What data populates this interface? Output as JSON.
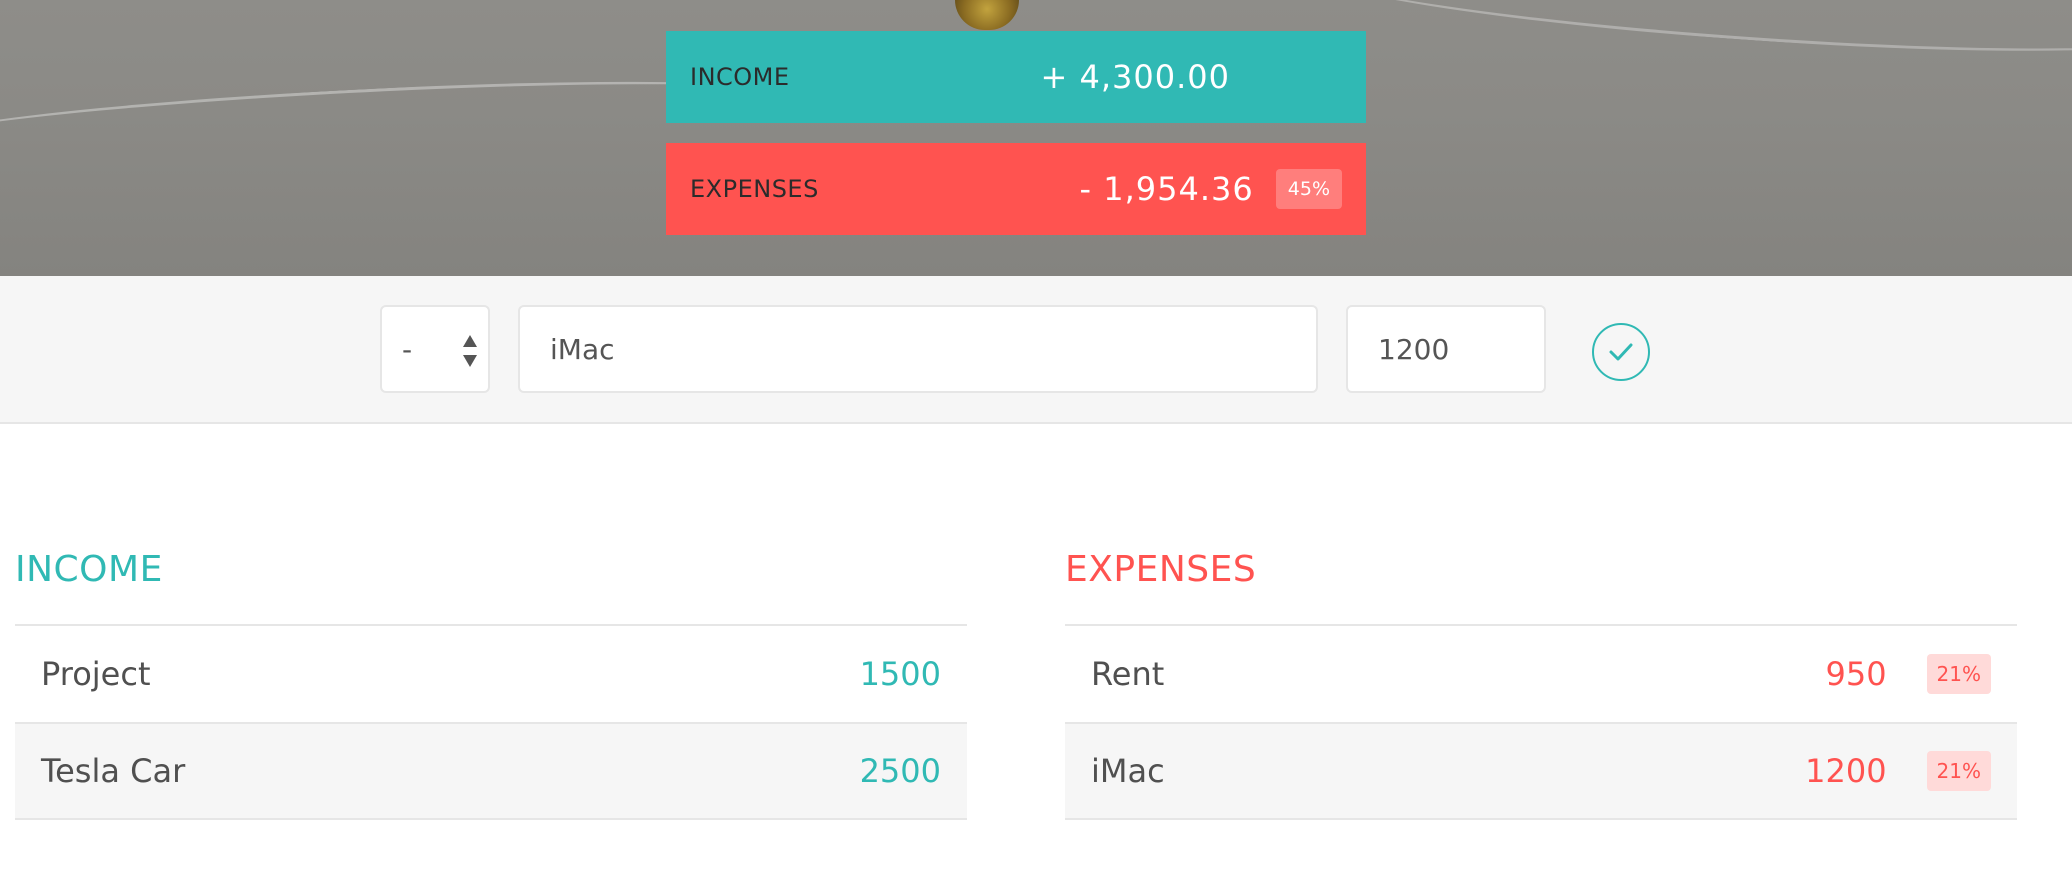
{
  "budget": {
    "income_label": "INCOME",
    "income_value": "+ 4,300.00",
    "expenses_label": "EXPENSES",
    "expenses_value": "- 1,954.36",
    "expenses_percentage": "45%"
  },
  "add_form": {
    "type_value": "-",
    "description_value": "iMac",
    "amount_value": "1200"
  },
  "income_list": {
    "title": "INCOME",
    "items": [
      {
        "description": "Project",
        "value": "1500"
      },
      {
        "description": "Tesla Car",
        "value": "2500"
      }
    ]
  },
  "expenses_list": {
    "title": "EXPENSES",
    "items": [
      {
        "description": "Rent",
        "value": "950",
        "percentage": "21%"
      },
      {
        "description": "iMac",
        "value": "1200",
        "percentage": "21%"
      }
    ]
  },
  "colors": {
    "income": "#30b9b4",
    "expenses": "#ff5350"
  },
  "icons": {
    "submit": "check-circle-icon",
    "select": "up-down-arrows-icon"
  }
}
